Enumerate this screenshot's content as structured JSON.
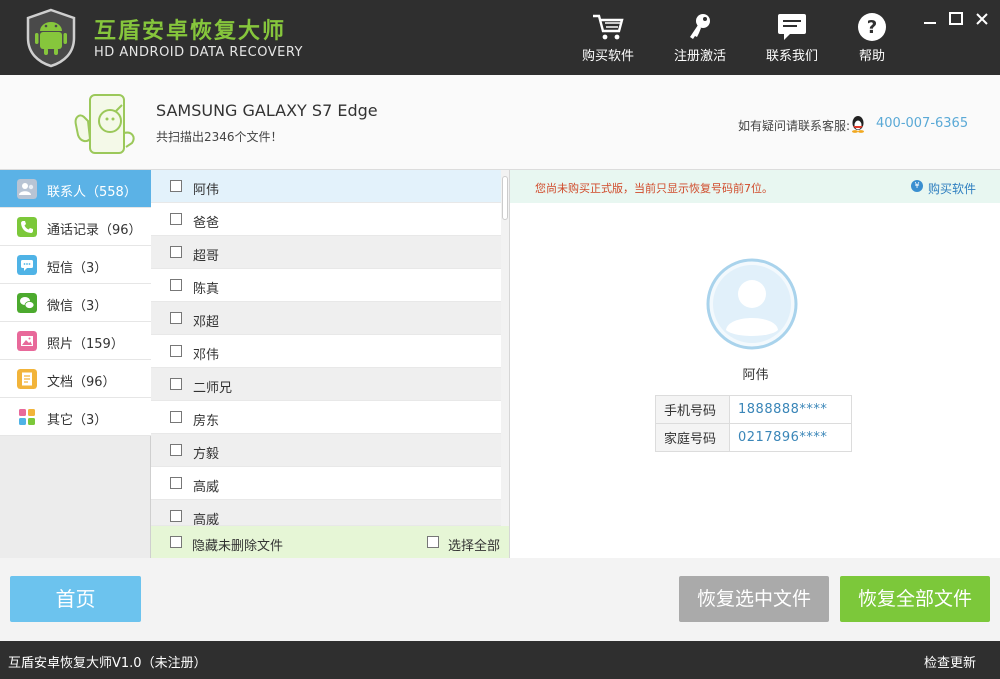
{
  "app": {
    "title": "互盾安卓恢复大师",
    "subtitle": "HD ANDROID DATA RECOVERY"
  },
  "nav": [
    {
      "label": "购买软件",
      "icon": "cart-icon"
    },
    {
      "label": "注册激活",
      "icon": "key-icon"
    },
    {
      "label": "联系我们",
      "icon": "chat-icon"
    },
    {
      "label": "帮助",
      "icon": "help-icon"
    }
  ],
  "device": {
    "name": "SAMSUNG  GALAXY S7 Edge",
    "scan_summary": "共扫描出2346个文件！",
    "support_label": "如有疑问请联系客服:",
    "support_phone": "400-007-6365"
  },
  "sidebar": {
    "items": [
      {
        "label": "联系人（558）",
        "icon": "contacts-icon",
        "color": "#9aa7b8",
        "active": true
      },
      {
        "label": "通话记录（96）",
        "icon": "phone-icon",
        "color": "#7cc83a",
        "active": false
      },
      {
        "label": "短信（3）",
        "icon": "sms-icon",
        "color": "#4fb3e6",
        "active": false
      },
      {
        "label": "微信（3）",
        "icon": "wechat-icon",
        "color": "#4caa2e",
        "active": false
      },
      {
        "label": "照片（159）",
        "icon": "photo-icon",
        "color": "#e8699a",
        "active": false
      },
      {
        "label": "文档（96）",
        "icon": "document-icon",
        "color": "#f2b43a",
        "active": false
      },
      {
        "label": "其它（3）",
        "icon": "other-icon",
        "color": "#ffffff",
        "active": false
      }
    ]
  },
  "contacts": {
    "rows": [
      "阿伟",
      "爸爸",
      "超哥",
      "陈真",
      "邓超",
      "邓伟",
      "二师兄",
      "房东",
      "方毅",
      "高威",
      "高威"
    ],
    "hide_undeleted_label": "隐藏未删除文件",
    "select_all_label": "选择全部"
  },
  "detail": {
    "notice": "您尚未购买正式版，当前只显示恢复号码前7位。",
    "buy_label": "购买软件",
    "name": "阿伟",
    "fields": [
      {
        "key": "手机号码",
        "value": "1888888****"
      },
      {
        "key": "家庭号码",
        "value": "0217896****"
      }
    ]
  },
  "actions": {
    "home": "首页",
    "recover_selected": "恢复选中文件",
    "recover_all": "恢复全部文件"
  },
  "status": {
    "version": "互盾安卓恢复大师V1.0（未注册）",
    "check_update": "检查更新"
  },
  "colors": {
    "brand_green": "#86c63c",
    "accent_blue": "#5bb2e6",
    "dark_bar": "#2f2f2f"
  }
}
